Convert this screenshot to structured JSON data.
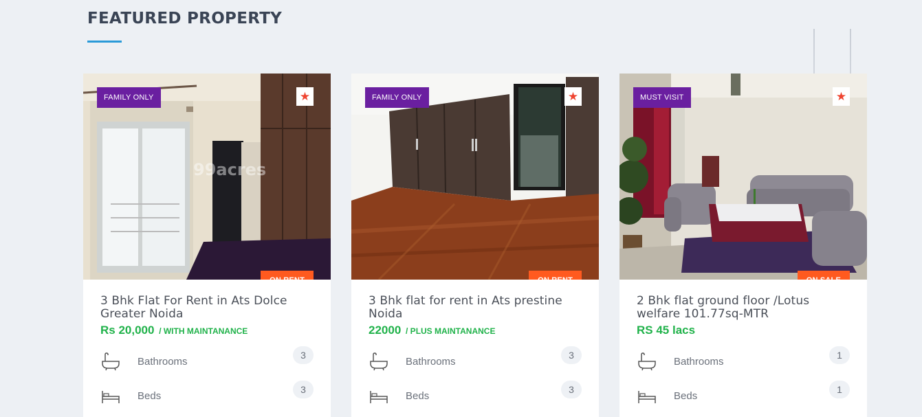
{
  "section": {
    "title": "FEATURED PROPERTY"
  },
  "cards": [
    {
      "tag": "FAMILY ONLY",
      "status": "ON RENT",
      "title": "3 Bhk Flat For Rent in Ats Dolce Greater Noida",
      "price": "Rs 20,000",
      "price_note": "/ WITH MAINTANANCE",
      "watermark": "99acres",
      "features": [
        {
          "label": "Bathrooms",
          "count": "3",
          "icon": "bathtub-icon"
        },
        {
          "label": "Beds",
          "count": "3",
          "icon": "bed-icon"
        }
      ]
    },
    {
      "tag": "FAMILY ONLY",
      "status": "ON RENT",
      "title": "3 Bhk flat for rent in Ats prestine Noida",
      "price": "22000",
      "price_note": "/ PLUS MAINTANANCE",
      "features": [
        {
          "label": "Bathrooms",
          "count": "3",
          "icon": "bathtub-icon"
        },
        {
          "label": "Beds",
          "count": "3",
          "icon": "bed-icon"
        }
      ]
    },
    {
      "tag": "MUST VISIT",
      "status": "ON SALE",
      "title": "2 Bhk flat ground floor /Lotus welfare 101.77sq-MTR",
      "price": "RS 45 lacs",
      "price_note": "",
      "features": [
        {
          "label": "Bathrooms",
          "count": "1",
          "icon": "bathtub-icon"
        },
        {
          "label": "Beds",
          "count": "1",
          "icon": "bed-icon"
        }
      ]
    }
  ],
  "icons": {
    "favorite": "star-icon"
  },
  "colors": {
    "background": "#edf0f4",
    "accent": "#2a9ad8",
    "tag_purple": "#6a1fa0",
    "status_orange": "#ff5a1f",
    "price_green": "#20b24a",
    "favorite_red": "#ef4531"
  }
}
